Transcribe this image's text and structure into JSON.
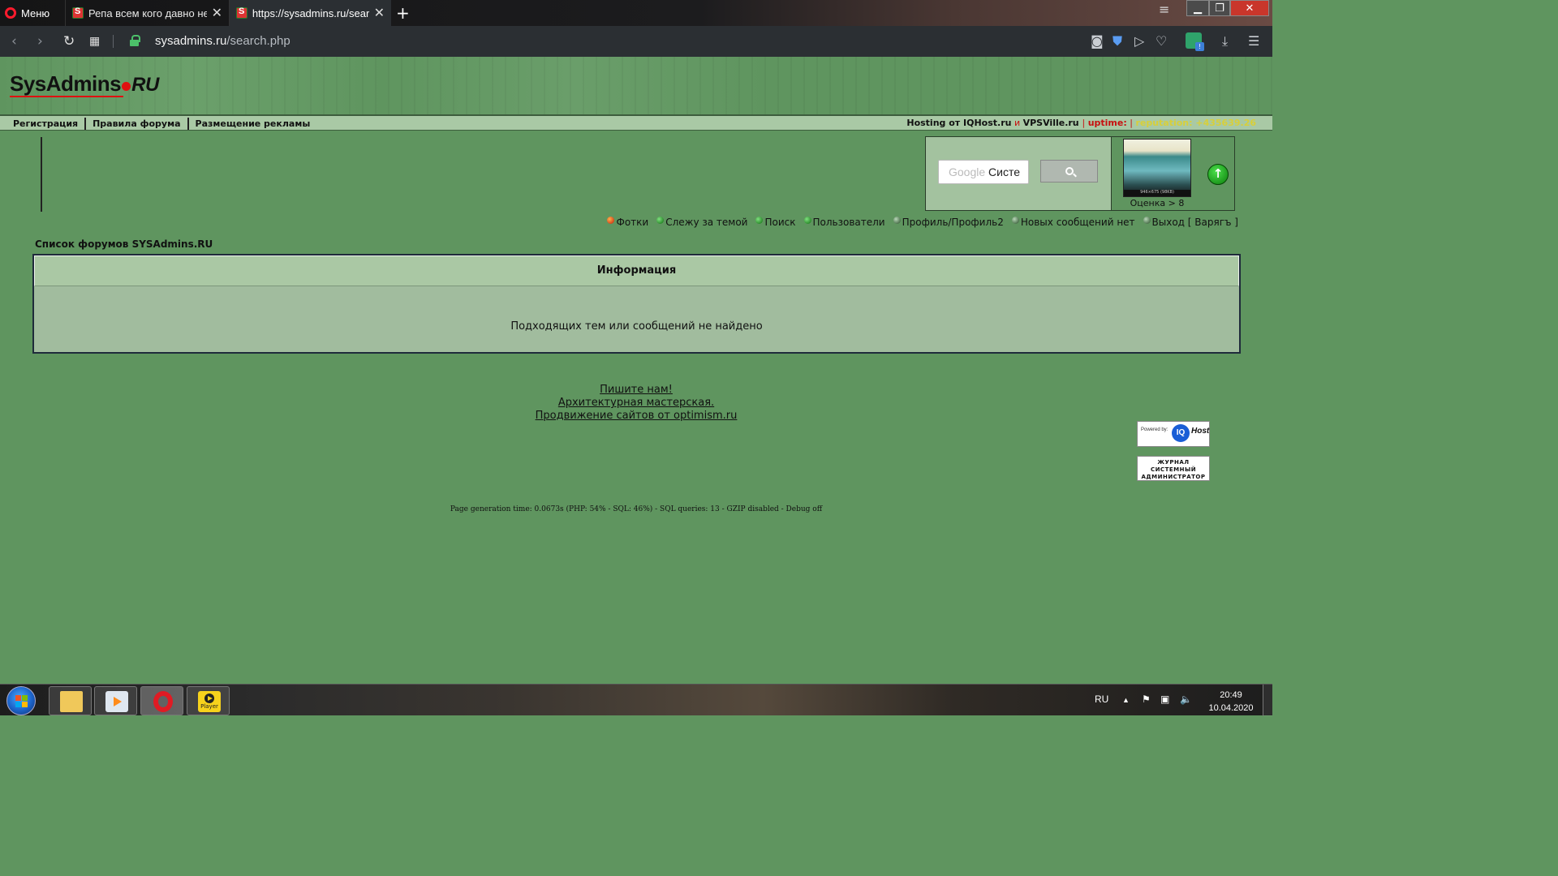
{
  "browser": {
    "menu_label": "Меню",
    "tabs": [
      {
        "title": "Репа всем кого давно не спал",
        "active": false
      },
      {
        "title": "https://sysadmins.ru/search.php",
        "active": true
      }
    ],
    "new_tab_label": "+",
    "url_host": "sysadmins.ru",
    "url_path": "/search.php"
  },
  "site": {
    "logo_main": "SysAdmins",
    "logo_suffix": "RU",
    "nav_links": [
      "Регистрация",
      "Правила форума",
      "Размещение рекламы"
    ],
    "hosting": {
      "prefix": "Hosting от ",
      "link1": "IQHost.ru",
      "and": " и ",
      "link2": "VPSVille.ru",
      "uptime_label": "uptime:",
      "reputation": "reputation: +435639.26"
    },
    "search": {
      "placeholder": "Систе",
      "google_label": "Google "
    },
    "rating_label": "Оценка > 8",
    "thumb_caption": "946×675 (98KB)",
    "user_menu": [
      {
        "label": "Фотки",
        "bullet": "red"
      },
      {
        "label": "Слежу за темой",
        "bullet": "grn"
      },
      {
        "label": "Поиск",
        "bullet": "grn"
      },
      {
        "label": "Пользователи",
        "bullet": "grn"
      },
      {
        "label": "Профиль/Профиль2",
        "bullet": "dk"
      },
      {
        "label": "Новых сообщений нет",
        "bullet": "dk"
      },
      {
        "label": "Выход [ Варягъ ]",
        "bullet": "dk"
      }
    ],
    "forum_list_label": "Список форумов SYSAdmins.RU",
    "info_title": "Информация",
    "info_message": "Подходящих тем или сообщений не найдено",
    "footer_links": [
      "Пишите нам!",
      "Архитектурная мастерская.",
      "Продвижение сайтов от optimism.ru"
    ],
    "badge_powered": "Powered by:",
    "badge_iq": "IQ",
    "badge_host": "Host",
    "badge_journal": [
      "ЖУРНАЛ",
      "СИСТЕМНЫЙ",
      "АДМИНИСТРАТОР"
    ],
    "page_generation": "Page generation time: 0.0673s (PHP: 54% - SQL: 46%) - SQL queries: 13 - GZIP disabled - Debug off"
  },
  "taskbar": {
    "player_label": "Player",
    "language": "RU",
    "time": "20:49",
    "date": "10.04.2020"
  },
  "colors": {
    "page_bg": "#5f955f",
    "info_panel": "#a1bc9e",
    "hosting_red": "#c81010",
    "reputation_yellow": "#d8cf3a"
  }
}
